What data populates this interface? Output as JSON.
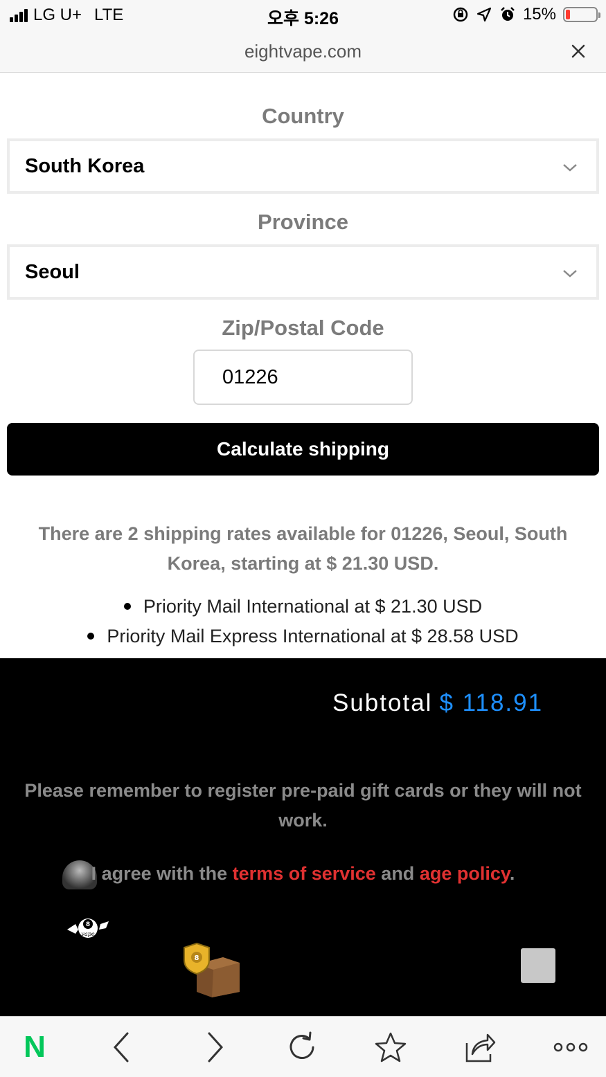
{
  "status_bar": {
    "carrier": "LG U+",
    "network": "LTE",
    "time": "오후 5:26",
    "battery": "15%",
    "battery_level": 0.15
  },
  "browser": {
    "url": "eightvape.com"
  },
  "form": {
    "country_label": "Country",
    "country_value": "South Korea",
    "province_label": "Province",
    "province_value": "Seoul",
    "zip_label": "Zip/Postal Code",
    "zip_value": "01226",
    "calculate_button": "Calculate shipping"
  },
  "shipping": {
    "summary": "There are 2 shipping rates available for 01226, Seoul, South Korea, starting at $ 21.30 USD.",
    "rates": [
      "Priority Mail International at $ 21.30 USD",
      "Priority Mail Express International at $ 28.58 USD"
    ]
  },
  "cart": {
    "subtotal_label": "Subtotal",
    "subtotal_value": "$ 118.91",
    "gift_card_note": "Please remember to register pre-paid gift cards or they will not work.",
    "agree_prefix": "I agree with the ",
    "terms_link": "terms of service",
    "agree_middle": " and ",
    "age_link": "age policy",
    "agree_suffix": ".",
    "logo_text": "8 vape"
  },
  "colors": {
    "accent_blue": "#1e90ff",
    "link_red": "#e03131",
    "naver_green": "#03c75a"
  },
  "toolbar": {
    "home_logo": "N",
    "icons": [
      "naver-home-icon",
      "back-icon",
      "forward-icon",
      "reload-icon",
      "bookmark-star-icon",
      "share-icon",
      "more-icon"
    ]
  }
}
